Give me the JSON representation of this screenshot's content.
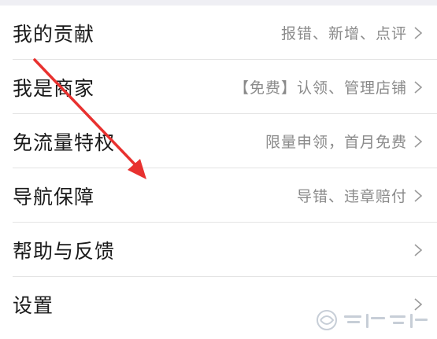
{
  "menu": {
    "items": [
      {
        "label": "我的贡献",
        "detail": "报错、新增、点评"
      },
      {
        "label": "我是商家",
        "detail": "【免费】认领、管理店铺"
      },
      {
        "label": "免流量特权",
        "detail": "限量申领，首月免费"
      },
      {
        "label": "导航保障",
        "detail": "导错、违章赔付"
      },
      {
        "label": "帮助与反馈",
        "detail": ""
      },
      {
        "label": "设置",
        "detail": ""
      }
    ]
  },
  "annotation": {
    "arrow_color": "#e8312f"
  },
  "icons": {
    "row_chevron": "chevron-right-icon",
    "watermark": "system-home-logo"
  }
}
